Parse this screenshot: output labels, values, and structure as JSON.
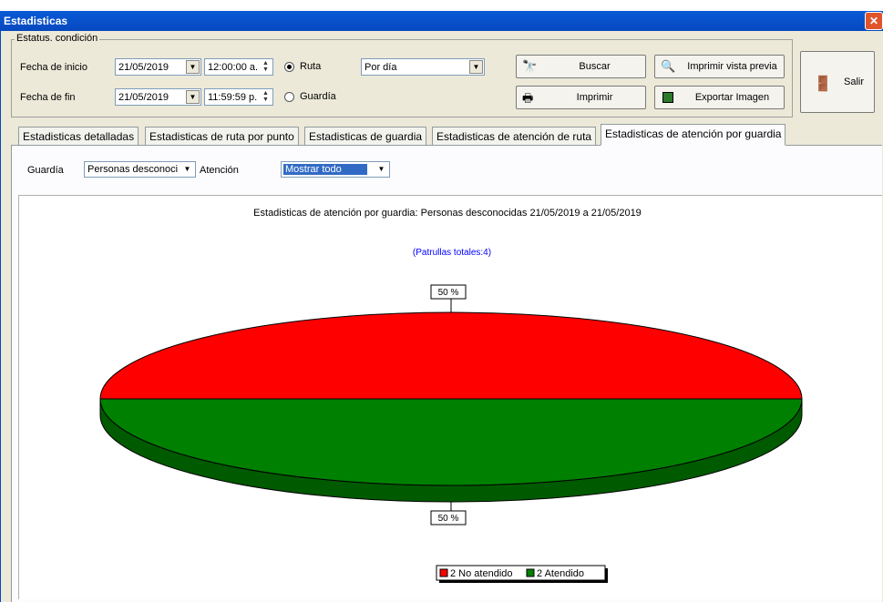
{
  "window": {
    "title": "Estadisticas"
  },
  "filter_group": {
    "title": "Estatus. condición",
    "start_label": "Fecha de inicio",
    "start_date": "21/05/2019",
    "start_time": "12:00:00 a.",
    "end_label": "Fecha de fin",
    "end_date": "21/05/2019",
    "end_time": "11:59:59 p.",
    "radio_route": "Ruta",
    "radio_guard": "Guardía",
    "radio_selected": "Ruta",
    "period_value": "Por día"
  },
  "buttons": {
    "search": "Buscar",
    "print_preview": "Imprimir vista previa",
    "print": "Imprimir",
    "export_image": "Exportar Imagen",
    "exit": "Salir"
  },
  "tabs": [
    {
      "label": "Estadisticas detalladas"
    },
    {
      "label": "Estadisticas de ruta por punto"
    },
    {
      "label": "Estadisticas de guardia"
    },
    {
      "label": "Estadisticas de atención de ruta"
    },
    {
      "label": "Estadisticas de atención por guardia"
    }
  ],
  "active_tab": 4,
  "sub_filter": {
    "guard_label": "Guardía",
    "guard_value": "Personas desconoci",
    "attention_label": "Atención",
    "attention_value": "Mostrar todo"
  },
  "chart_data": {
    "type": "pie",
    "title": "Estadisticas de atención por guardia: Personas desconocidas 21/05/2019 a 21/05/2019",
    "subtitle": "(Patrullas totales:4)",
    "slices": [
      {
        "label": "No atendido",
        "value": 2,
        "percent_label": "50 %",
        "color": "#ff0000",
        "legend": "2 No atendido"
      },
      {
        "label": "Atendido",
        "value": 2,
        "percent_label": "50 %",
        "color": "#008000",
        "legend": "2 Atendido"
      }
    ],
    "legend_position": "bottom-center",
    "subtitle_color": "#0000ff"
  }
}
